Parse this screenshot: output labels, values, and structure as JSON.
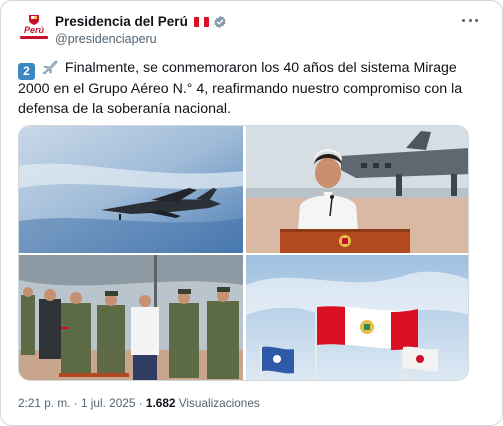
{
  "account": {
    "display_name": "Presidencia del Perú",
    "handle": "@presidenciaperu",
    "avatar_text": "Perú"
  },
  "post": {
    "number_badge": "2",
    "text": "Finalmente, se conmemoraron los 40 años del sistema Mirage 2000 en el Grupo Aéreo N.° 4, reafirmando nuestro compromiso con la defensa de la soberanía nacional."
  },
  "media": [
    {
      "description_icon": "jet-photo"
    },
    {
      "description_icon": "president-podium-photo"
    },
    {
      "description_icon": "officials-saluting-photo"
    },
    {
      "description_icon": "flags-photo"
    }
  ],
  "footer": {
    "time": "2:21 p. m.",
    "separator": "·",
    "date": "1 jul. 2025",
    "views_count": "1.682",
    "views_label": "Visualizaciones"
  },
  "colors": {
    "peru_red": "#c8102e",
    "verified_gray": "#829aab",
    "secondary_text": "#536471",
    "border": "#cfd9de"
  }
}
